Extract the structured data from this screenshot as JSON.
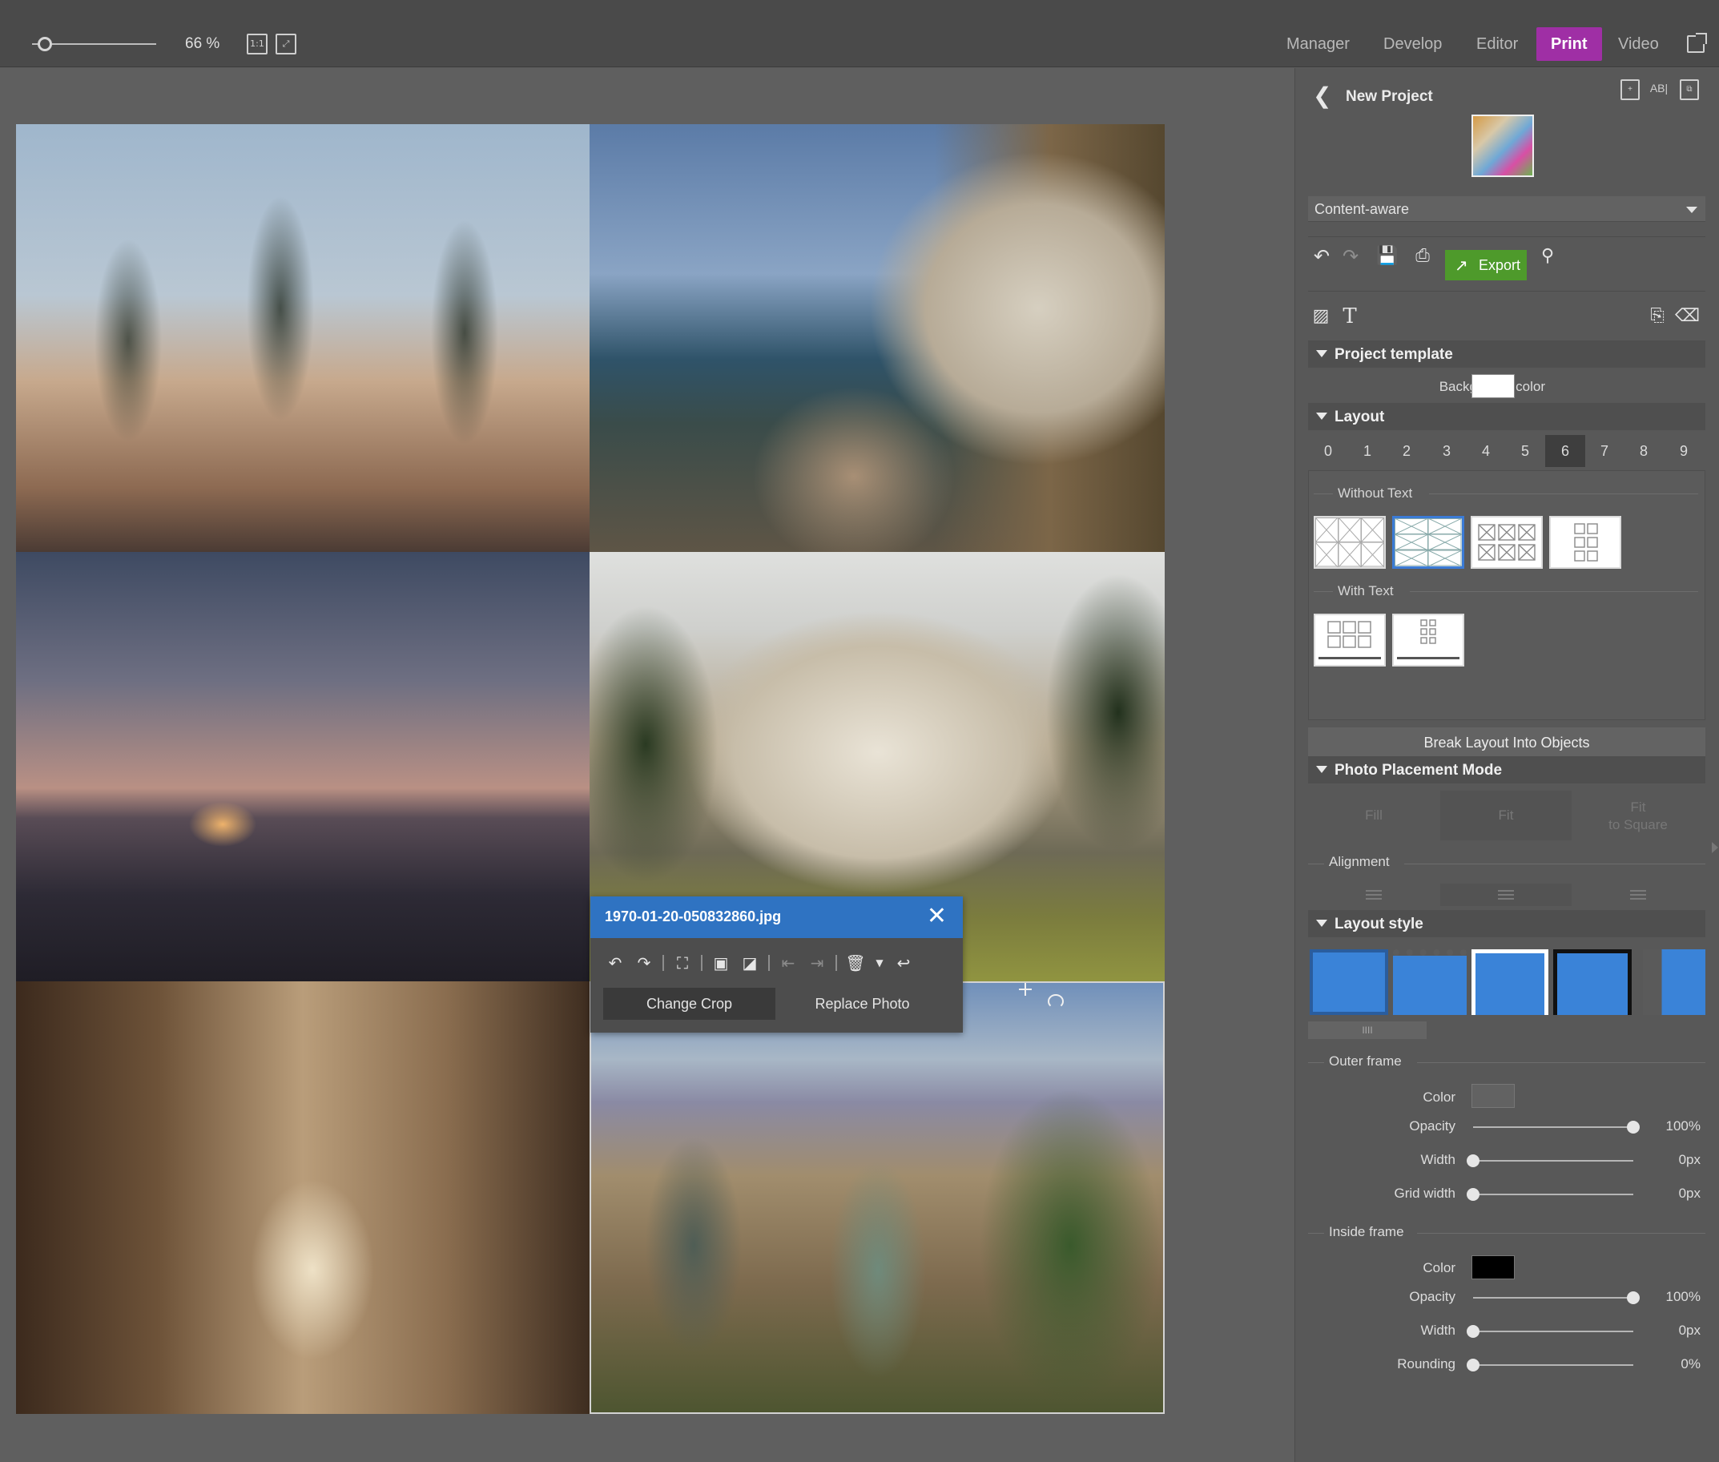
{
  "topbar": {
    "zoom_value": 66,
    "zoom_label": "66 %",
    "actual_size_icon": "1:1",
    "fit_icon": "fit-screen-icon",
    "nav": [
      {
        "label": "Manager",
        "active": false
      },
      {
        "label": "Develop",
        "active": false
      },
      {
        "label": "Editor",
        "active": false
      },
      {
        "label": "Print",
        "active": true
      },
      {
        "label": "Video",
        "active": false
      }
    ],
    "accent_color": "#9f2fa5"
  },
  "popup": {
    "filename": "1970-01-20-050832860.jpg",
    "change_crop": "Change Crop",
    "replace_photo": "Replace Photo",
    "header_color": "#2f73c2"
  },
  "panel": {
    "title": "New Project",
    "mode_select": "Content-aware",
    "export_label": "Export",
    "export_color": "#4e9a2b",
    "project_template": {
      "heading": "Project template",
      "bg_label": "Background color",
      "bg_color": "#ffffff"
    },
    "layout": {
      "heading": "Layout",
      "numbers": [
        "0",
        "1",
        "2",
        "3",
        "4",
        "5",
        "6",
        "7",
        "8",
        "9"
      ],
      "selected": "6",
      "without_text": "Without Text",
      "with_text": "With Text"
    },
    "break_label": "Break Layout Into Objects",
    "placement": {
      "heading": "Photo Placement Mode",
      "fill": "Fill",
      "fit": "Fit",
      "fit_square_1": "Fit",
      "fit_square_2": "to Square",
      "alignment": "Alignment"
    },
    "layout_style": {
      "heading": "Layout style",
      "scroll_glyph": "IIII"
    },
    "outer_frame": {
      "heading": "Outer frame",
      "color_label": "Color",
      "opacity_label": "Opacity",
      "opacity_value": "100%",
      "opacity": 1.0,
      "width_label": "Width",
      "width_value": "0px",
      "width": 0,
      "grid_label": "Grid width",
      "grid_value": "0px",
      "grid": 0
    },
    "inside_frame": {
      "heading": "Inside frame",
      "color_label": "Color",
      "color": "#000000",
      "opacity_label": "Opacity",
      "opacity_value": "100%",
      "opacity": 1.0,
      "width_label": "Width",
      "width_value": "0px",
      "width": 0,
      "rounding_label": "Rounding",
      "rounding_value": "0%",
      "rounding": 0
    }
  }
}
